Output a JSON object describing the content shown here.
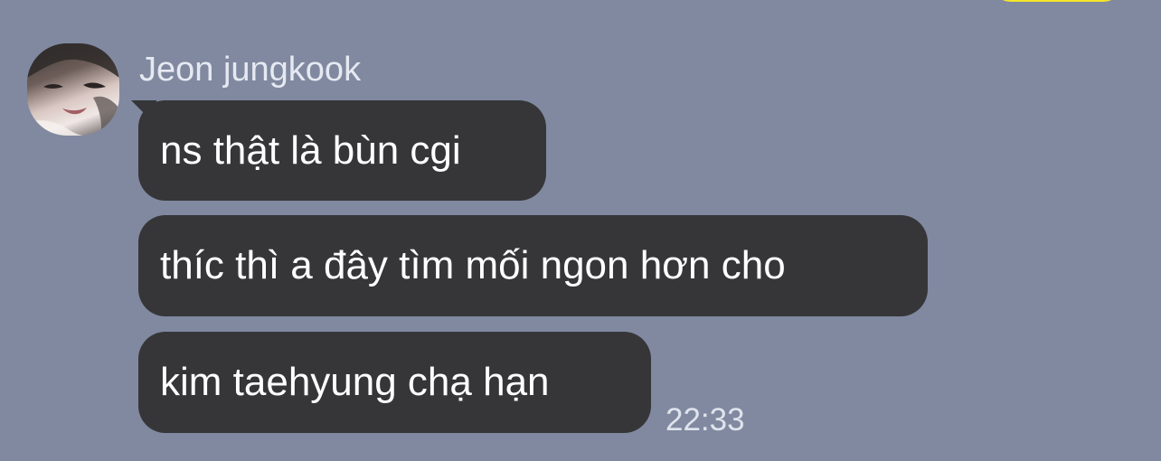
{
  "chat": {
    "sender_name": "Jeon jungkook",
    "messages": [
      {
        "text": "ns thật là bùn cgi"
      },
      {
        "text": "thíc thì a đây tìm mối ngon hơn cho"
      },
      {
        "text": "kim taehyung chạ hạn"
      }
    ],
    "timestamp": "22:33"
  },
  "colors": {
    "background": "#8089a0",
    "incoming_bubble": "#363639",
    "outgoing_bubble": "#f5e52b",
    "sender_name": "#e6e9f1",
    "timestamp": "#dfe3ec"
  }
}
